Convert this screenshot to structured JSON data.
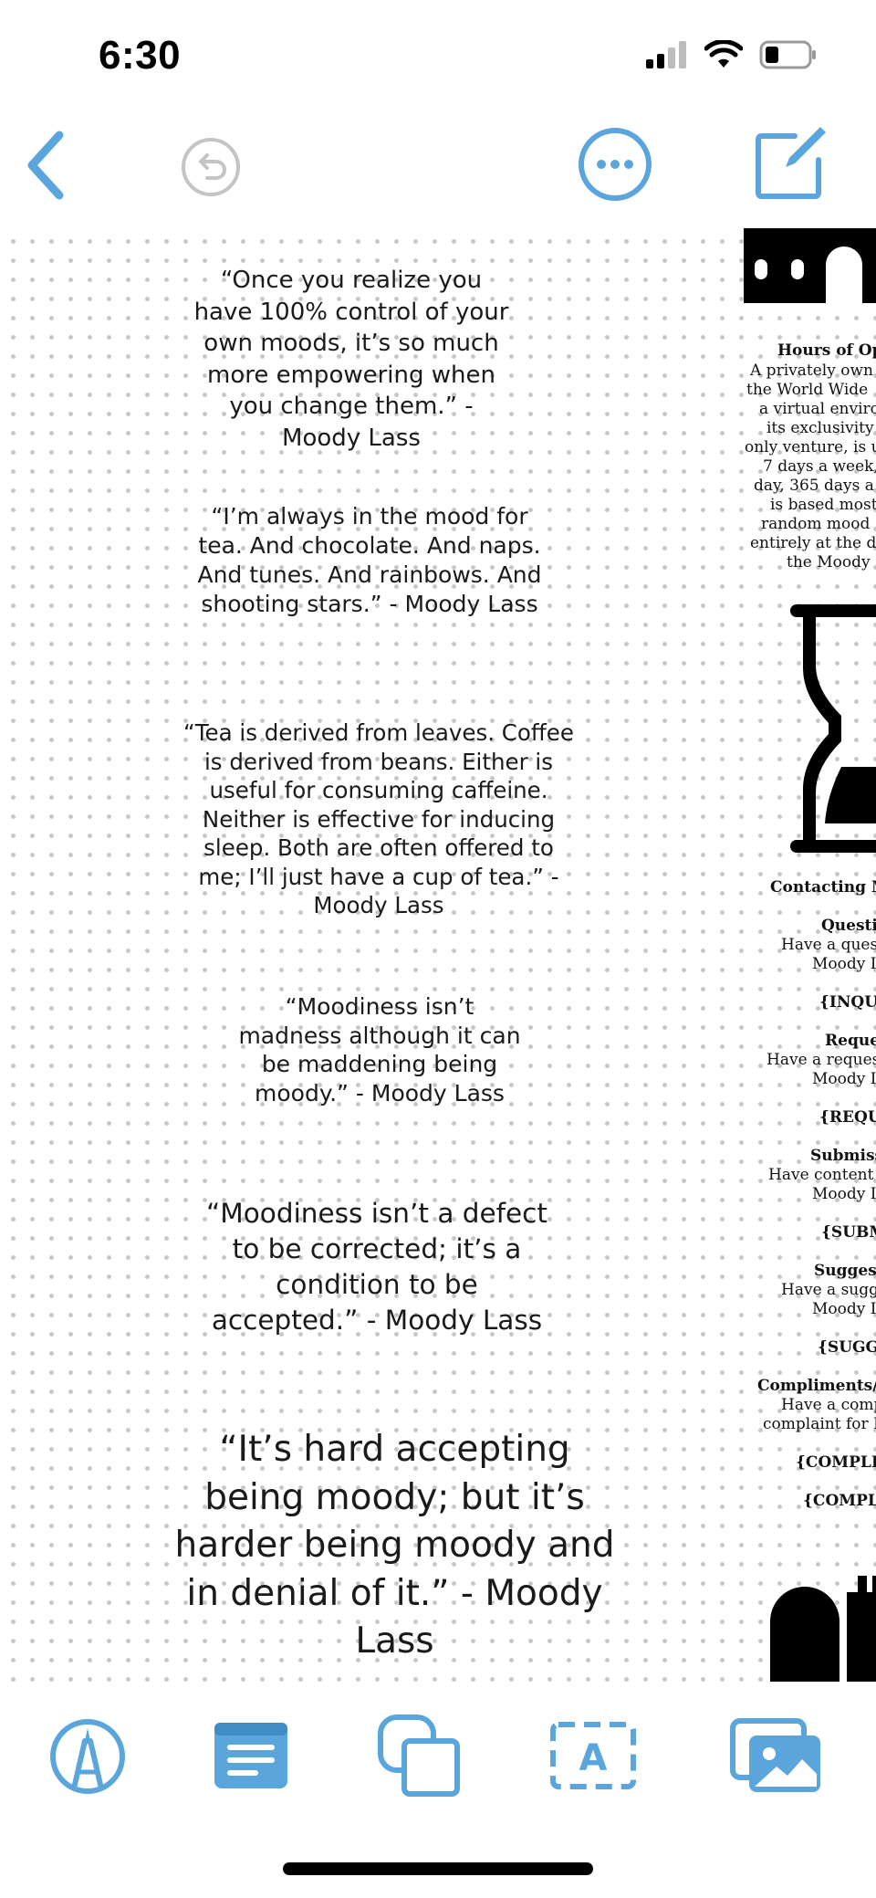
{
  "status_bar": {
    "time": "6:30",
    "icons": [
      "cellular-signal-icon",
      "wifi-icon",
      "battery-icon"
    ]
  },
  "toolbar": {
    "back_icon": "chevron-left-icon",
    "undo_icon": "undo-icon",
    "more_icon": "ellipsis-circle-icon",
    "compose_icon": "compose-icon"
  },
  "canvas": {
    "quotes": [
      {
        "text": "“Once you realize you have 100% control of your own moods, it’s so much more empowering when you change them.” - Moody Lass"
      },
      {
        "text": "“I’m always in the mood for tea. And chocolate. And naps. And tunes. And rainbows. And shooting stars.” - Moody Lass"
      },
      {
        "text": "“Tea is derived from leaves. Coffee is derived from beans. Either is useful for consuming caffeine. Neither is effective for inducing sleep. Both are often offered to me; I’ll just have a cup of tea.” - Moody Lass"
      },
      {
        "text": "“Moodiness isn’t madness although it can be maddening being moody.” - Moody Lass"
      },
      {
        "text": "“Moodiness isn’t a defect to be corrected; it’s a condition to be accepted.” - Moody Lass"
      },
      {
        "text": "“It’s hard accepting being moody; but it’s harder being moody and in denial of it.” - Moody Lass"
      }
    ],
    "document": {
      "hours_heading": "Hours of Op",
      "hours_lines": [
        "A privately own",
        "the World Wide",
        "a virtual environ",
        "its exclusivity a",
        "only venture, is u",
        "7 days a week,",
        "day, 365 days a",
        "is based most",
        "random mood",
        "entirely at the d",
        "the Moody"
      ],
      "contact_heading": "Contacting M",
      "sections": [
        {
          "title": "Questio",
          "lines": [
            "Have a quest",
            "Moody I"
          ],
          "tag": "{INQUI"
        },
        {
          "title": "Reque",
          "lines": [
            "Have a request",
            "Moody I"
          ],
          "tag": "{REQU"
        },
        {
          "title": "Submiss",
          "lines": [
            "Have content t",
            "Moody I"
          ],
          "tag": "{SUBM"
        },
        {
          "title": "Suggest",
          "lines": [
            "Have a sugg",
            "Moody I"
          ],
          "tag": "{SUGG"
        },
        {
          "title": "Compliments/C",
          "lines": [
            "Have a comp",
            "complaint for M"
          ],
          "tag": "{COMPLI"
        }
      ],
      "extra_tag": "{COMPL"
    }
  },
  "bottom_toolbar": {
    "tools": [
      "pen-tool-icon",
      "text-box-icon",
      "shapes-icon",
      "text-field-icon",
      "photos-icon"
    ]
  },
  "colors": {
    "accent": "#5aa6dc",
    "disabled": "#c4c4c4",
    "text": "#111111",
    "dot": "#c6c6c6"
  }
}
